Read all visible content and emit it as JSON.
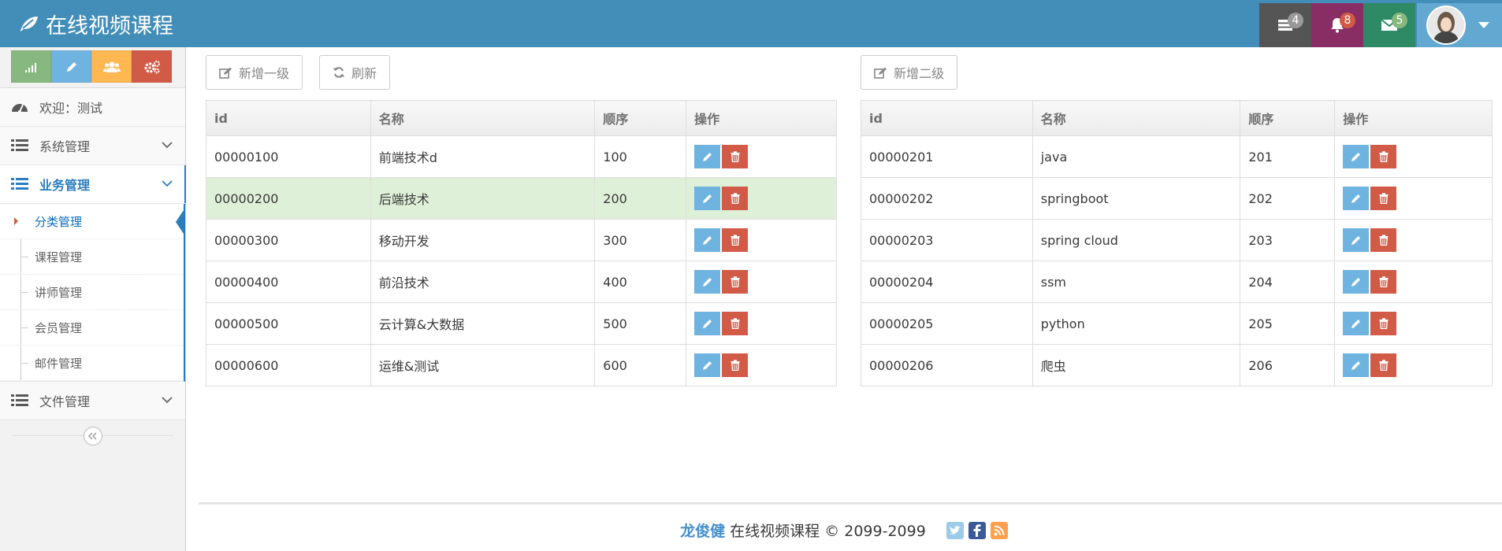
{
  "app": {
    "title": "在线视频课程"
  },
  "navbar": {
    "tasks_count": "4",
    "notifications_count": "8",
    "messages_count": "5"
  },
  "sidebar": {
    "welcome": "欢迎：测试",
    "menus": [
      {
        "label": "系统管理"
      },
      {
        "label": "业务管理"
      },
      {
        "label": "文件管理"
      }
    ],
    "sub_items": [
      {
        "label": "分类管理"
      },
      {
        "label": "课程管理"
      },
      {
        "label": "讲师管理"
      },
      {
        "label": "会员管理"
      },
      {
        "label": "邮件管理"
      }
    ]
  },
  "toolbar": {
    "add_level1": "新增一级",
    "refresh": "刷新",
    "add_level2": "新增二级"
  },
  "level1_table": {
    "headers": [
      "id",
      "名称",
      "顺序",
      "操作"
    ],
    "rows": [
      {
        "id": "00000100",
        "name": "前端技术d",
        "order": "100"
      },
      {
        "id": "00000200",
        "name": "后端技术",
        "order": "200"
      },
      {
        "id": "00000300",
        "name": "移动开发",
        "order": "300"
      },
      {
        "id": "00000400",
        "name": "前沿技术",
        "order": "400"
      },
      {
        "id": "00000500",
        "name": "云计算&大数据",
        "order": "500"
      },
      {
        "id": "00000600",
        "name": "运维&测试",
        "order": "600"
      }
    ]
  },
  "level2_table": {
    "headers": [
      "id",
      "名称",
      "顺序",
      "操作"
    ],
    "rows": [
      {
        "id": "00000201",
        "name": "java",
        "order": "201"
      },
      {
        "id": "00000202",
        "name": "springboot",
        "order": "202"
      },
      {
        "id": "00000203",
        "name": "spring cloud",
        "order": "203"
      },
      {
        "id": "00000204",
        "name": "ssm",
        "order": "204"
      },
      {
        "id": "00000205",
        "name": "python",
        "order": "205"
      },
      {
        "id": "00000206",
        "name": "爬虫",
        "order": "206"
      }
    ]
  },
  "footer": {
    "author": "龙俊健",
    "text": "在线视频课程 © 2099-2099"
  },
  "colors": {
    "navbar": "#438eb9",
    "selected_row": "#dff0d8",
    "edit_button": "#6fb3e0",
    "delete_button": "#d15b47"
  }
}
